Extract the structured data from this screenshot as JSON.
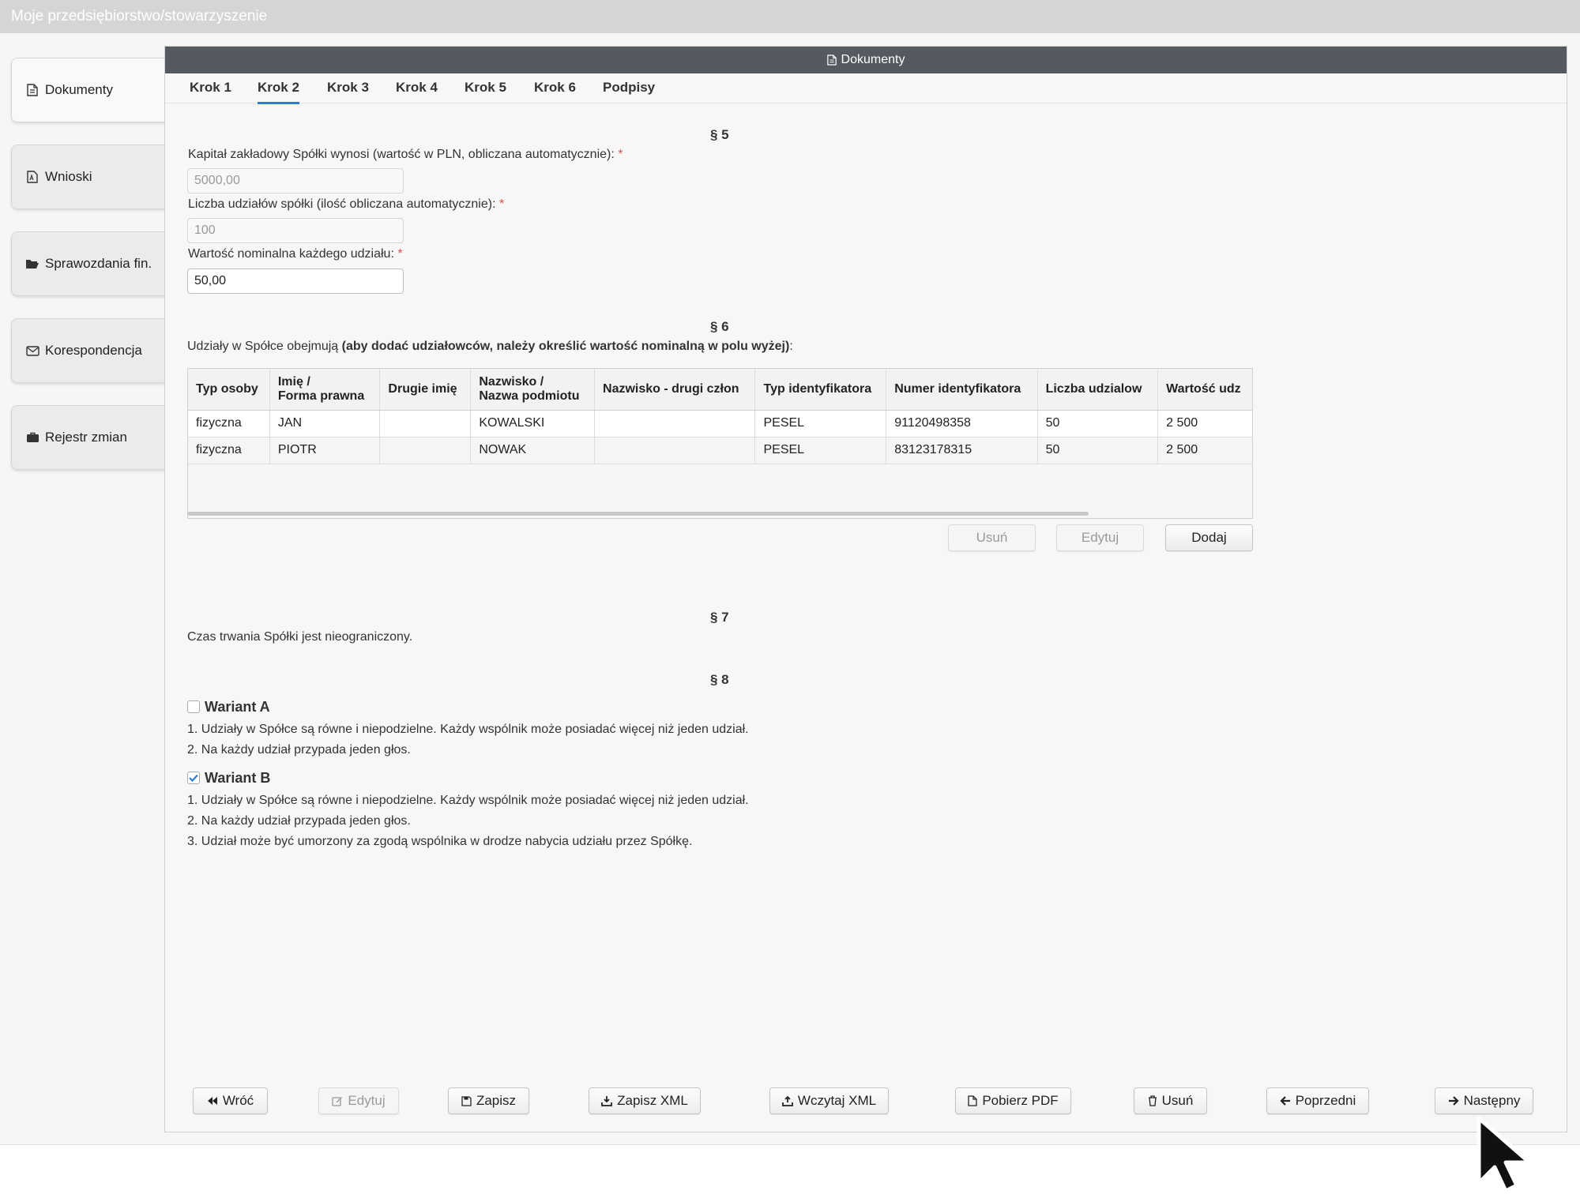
{
  "topbar": {
    "title": "Moje przedsiębiorstwo/stowarzyszenie"
  },
  "sidebar": {
    "items": [
      {
        "label": "Dokumenty",
        "icon": "document-icon"
      },
      {
        "label": "Wnioski",
        "icon": "file-icon"
      },
      {
        "label": "Sprawozdania fin.",
        "icon": "folder-open-icon"
      },
      {
        "label": "Korespondencja",
        "icon": "envelope-icon"
      },
      {
        "label": "Rejestr zmian",
        "icon": "briefcase-icon"
      }
    ]
  },
  "panel": {
    "title": "Dokumenty"
  },
  "tabs": [
    {
      "label": "Krok 1"
    },
    {
      "label": "Krok 2",
      "active": true
    },
    {
      "label": "Krok 3"
    },
    {
      "label": "Krok 4"
    },
    {
      "label": "Krok 5"
    },
    {
      "label": "Krok 6"
    },
    {
      "label": "Podpisy"
    }
  ],
  "section5": {
    "heading": "§ 5",
    "capital_label": "Kapitał zakładowy Spółki wynosi (wartość w PLN, obliczana automatycznie):",
    "capital_value": "5000,00",
    "shares_label": "Liczba udziałów spółki (ilość obliczana automatycznie):",
    "shares_value": "100",
    "nominal_label": "Wartość nominalna każdego udziału:",
    "nominal_value": "50,00",
    "required_mark": "*"
  },
  "section6": {
    "heading": "§ 6",
    "intro_plain": "Udziały w Spółce obejmują ",
    "intro_bold": "(aby dodać udziałowców, należy określić wartość nominalną w polu wyżej)",
    "intro_end": ":",
    "columns": [
      "Typ osoby",
      "Imię /\nForma prawna",
      "Drugie imię",
      "Nazwisko /\nNazwa podmiotu",
      "Nazwisko - drugi człon",
      "Typ identyfikatora",
      "Numer identyfikatora",
      "Liczba udzialow",
      "Wartość udz"
    ],
    "rows": [
      [
        "fizyczna",
        "JAN",
        "",
        "KOWALSKI",
        "",
        "PESEL",
        "91120498358",
        "50",
        "2 500"
      ],
      [
        "fizyczna",
        "PIOTR",
        "",
        "NOWAK",
        "",
        "PESEL",
        "83123178315",
        "50",
        "2 500"
      ]
    ],
    "buttons": {
      "remove": "Usuń",
      "edit": "Edytuj",
      "add": "Dodaj"
    }
  },
  "section7": {
    "heading": "§ 7",
    "text": "Czas trwania Spółki jest nieograniczony."
  },
  "section8": {
    "heading": "§ 8",
    "variant_a": {
      "label": "Wariant A",
      "checked": false,
      "lines": [
        "1. Udziały w Spółce są równe i niepodzielne. Każdy wspólnik może posiadać więcej niż jeden udział.",
        "2. Na każdy udział przypada jeden głos."
      ]
    },
    "variant_b": {
      "label": "Wariant B",
      "checked": true,
      "lines": [
        "1. Udziały w Spółce są równe i niepodzielne. Każdy wspólnik może posiadać więcej niż jeden udział.",
        "2. Na każdy udział przypada jeden głos.",
        "3. Udział może być umorzony za zgodą wspólnika w drodze nabycia udziału przez Spółkę."
      ]
    }
  },
  "footer": {
    "back": "Wróć",
    "edit": "Edytuj",
    "save": "Zapisz",
    "save_xml": "Zapisz XML",
    "load_xml": "Wczytaj XML",
    "download_pdf": "Pobierz PDF",
    "delete": "Usuń",
    "previous": "Poprzedni",
    "next": "Następny"
  },
  "colors": {
    "accent": "#2d7dd2",
    "panel_header": "#555a60",
    "required": "#d9534f"
  }
}
